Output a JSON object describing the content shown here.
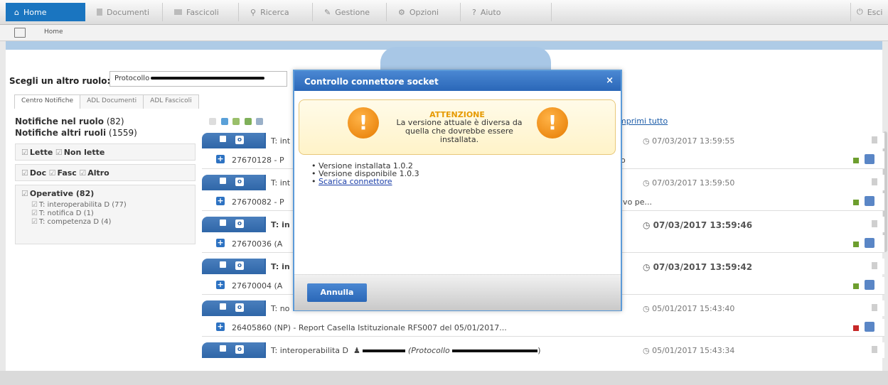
{
  "nav": {
    "tabs": [
      {
        "label": "Home",
        "icon": "home-icon"
      },
      {
        "label": "Documenti",
        "icon": "document-icon"
      },
      {
        "label": "Fascicoli",
        "icon": "folder-icon"
      },
      {
        "label": "Ricerca",
        "icon": "search-icon"
      },
      {
        "label": "Gestione",
        "icon": "pencil-icon"
      },
      {
        "label": "Opzioni",
        "icon": "options-icon"
      },
      {
        "label": "Aiuto",
        "icon": "help-icon"
      }
    ],
    "exit": "Esci"
  },
  "breadcrumb": {
    "label": "Home"
  },
  "role": {
    "label": "Scegli un altro ruolo:",
    "value": "Protocollo"
  },
  "subtabs": [
    "Centro Notifiche",
    "ADL Documenti",
    "ADL Fascicoli"
  ],
  "sidebar": {
    "notif_role_label": "Notifiche nel ruolo",
    "notif_role_count": "(82)",
    "notif_other_label": "Notifiche altri ruoli",
    "notif_other_count": "(1559)",
    "filter1": [
      "Lette",
      "Non lette"
    ],
    "filter2": [
      "Doc",
      "Fasc",
      "Altro"
    ],
    "operative": "Operative (82)",
    "operative_items": [
      "T: interoperabilita D (77)",
      "T: notifica D (1)",
      "T: competenza D (4)"
    ]
  },
  "expand_all": "mprimi tutto",
  "notifications": [
    {
      "title": "T: int",
      "date": "07/03/2017 13:59:55",
      "bold": false,
      "row": "27670128 - P",
      "tail": "o",
      "flag": "green"
    },
    {
      "title": "T: int",
      "date": "07/03/2017 13:59:50",
      "bold": false,
      "row": "27670082 - P",
      "tail": "ivo pe...",
      "flag": "green"
    },
    {
      "title": "T: in",
      "date": "07/03/2017 13:59:46",
      "bold": true,
      "row": "27670036 (A",
      "tail": "",
      "flag": "green"
    },
    {
      "title": "T: in",
      "date": "07/03/2017 13:59:42",
      "bold": true,
      "row": "27670004 (A",
      "tail": "",
      "flag": "green"
    },
    {
      "title": "T: no",
      "date": "05/01/2017 15:43:40",
      "bold": false,
      "row": "26405860 (NP) - Report Casella Istituzionale RFS007 del 05/01/2017...",
      "tail": "",
      "flag": "red"
    },
    {
      "title": "T: interoperabilita D",
      "title_extra": "(Protocollo",
      "date": "05/01/2017 15:43:34",
      "bold": false
    }
  ],
  "modal": {
    "title": "Controllo connettore socket",
    "close": "×",
    "alert_title": "ATTENZIONE",
    "alert_msg": "La versione attuale è diversa da quella che dovrebbe essere installata.",
    "installed": "Versione installata 1.0.2",
    "available": "Versione disponibile 1.0.3",
    "download": "Scarica connettore",
    "cancel": "Annulla"
  },
  "colors": {
    "accent": "#2a67b8",
    "warning": "#e57a00"
  }
}
